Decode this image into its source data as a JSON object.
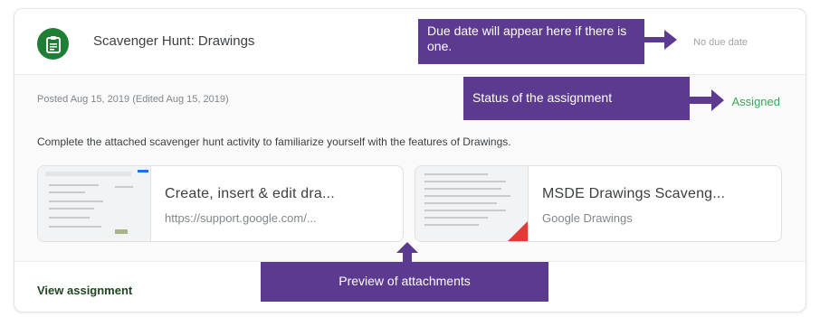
{
  "assignment": {
    "title": "Scavenger Hunt: Drawings",
    "due": "No due date",
    "posted": "Posted Aug 15, 2019 (Edited Aug 15, 2019)",
    "status": "Assigned",
    "description": "Complete the attached scavenger hunt activity to familiarize yourself with the features of Drawings.",
    "view_link": "View assignment"
  },
  "attachments": [
    {
      "title": "Create, insert & edit dra...",
      "subtitle": "https://support.google.com/..."
    },
    {
      "title": "MSDE Drawings Scaveng...",
      "subtitle": "Google Drawings"
    }
  ],
  "callouts": {
    "due": "Due date will appear here if there is one.",
    "status": "Status of the assignment",
    "preview": "Preview of attachments"
  },
  "colors": {
    "icon_bg": "#1e7e34",
    "status_green": "#3aa757",
    "callout_purple": "#5b3a8f"
  },
  "icons": {
    "assignment": "assignment-icon"
  }
}
